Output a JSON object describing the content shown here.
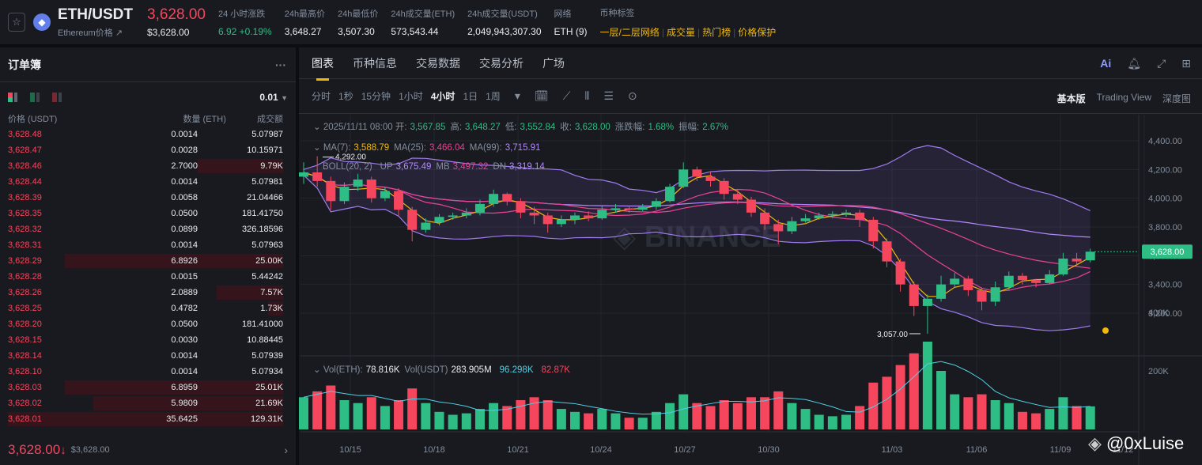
{
  "header": {
    "pair": "ETH/USDT",
    "subtitle": "Ethereum价格",
    "price": "3,628.00",
    "price_usd": "$3,628.00",
    "stats": [
      {
        "label": "24 小时涨跌",
        "value": "6.92 +0.19%",
        "color": "green"
      },
      {
        "label": "24h最高价",
        "value": "3,648.27"
      },
      {
        "label": "24h最低价",
        "value": "3,507.30"
      },
      {
        "label": "24h成交量(ETH)",
        "value": "573,543.44"
      },
      {
        "label": "24h成交量(USDT)",
        "value": "2,049,943,307.30"
      },
      {
        "label": "网络",
        "value": "ETH (9)"
      }
    ],
    "tags_label": "币种标签",
    "tags": [
      "一层/二层网络",
      "成交量",
      "热门榜",
      "价格保护"
    ]
  },
  "orderbook": {
    "title": "订单簿",
    "more": "···",
    "precision": "0.01",
    "cols": [
      "价格 (USDT)",
      "数量 (ETH)",
      "成交额"
    ],
    "rows": [
      [
        "3,628.48",
        "0.0014",
        "5.07987"
      ],
      [
        "3,628.47",
        "0.0028",
        "10.15971"
      ],
      [
        "3,628.46",
        "2.7000",
        "9.79K"
      ],
      [
        "3,628.44",
        "0.0014",
        "5.07981"
      ],
      [
        "3,628.39",
        "0.0058",
        "21.04466"
      ],
      [
        "3,628.35",
        "0.0500",
        "181.41750"
      ],
      [
        "3,628.32",
        "0.0899",
        "326.18596"
      ],
      [
        "3,628.31",
        "0.0014",
        "5.07963"
      ],
      [
        "3,628.29",
        "6.8926",
        "25.00K"
      ],
      [
        "3,628.28",
        "0.0015",
        "5.44242"
      ],
      [
        "3,628.26",
        "2.0889",
        "7.57K"
      ],
      [
        "3,628.25",
        "0.4782",
        "1.73K"
      ],
      [
        "3,628.20",
        "0.0500",
        "181.41000"
      ],
      [
        "3,628.15",
        "0.0030",
        "10.88445"
      ],
      [
        "3,628.14",
        "0.0014",
        "5.07939"
      ],
      [
        "3,628.10",
        "0.0014",
        "5.07934"
      ],
      [
        "3,628.03",
        "6.8959",
        "25.01K"
      ],
      [
        "3,628.02",
        "5.9809",
        "21.69K"
      ],
      [
        "3,628.01",
        "35.6425",
        "129.31K"
      ]
    ],
    "last_price": "3,628.00",
    "last_arrow": "↓",
    "last_usd": "$3,628.00"
  },
  "tabs": [
    "图表",
    "币种信息",
    "交易数据",
    "交易分析",
    "广场"
  ],
  "toolbar": {
    "intervals": [
      "分时",
      "1秒",
      "15分钟",
      "1小时",
      "4小时",
      "1日",
      "1周"
    ],
    "active": "4小时",
    "views": [
      "基本版",
      "Trading View",
      "深度图"
    ],
    "active_view": "基本版"
  },
  "legend": {
    "date": "2025/11/11 08:00",
    "ohlc": [
      [
        "开:",
        "3,567.85"
      ],
      [
        "高:",
        "3,648.27"
      ],
      [
        "低:",
        "3,552.84"
      ],
      [
        "收:",
        "3,628.00"
      ],
      [
        "涨跌幅:",
        "1.68%"
      ],
      [
        "振幅:",
        "2.67%"
      ]
    ],
    "ma": [
      [
        "MA(7):",
        "3,588.79",
        "#f0b90b"
      ],
      [
        "MA(25):",
        "3,466.04",
        "#e84393"
      ],
      [
        "MA(99):",
        "3,715.91",
        "#b388ff"
      ]
    ],
    "boll": [
      [
        "BOLL(20, 2)",
        ""
      ],
      [
        "UP",
        "3,675.49"
      ],
      [
        "MB",
        "3,497.32"
      ],
      [
        "DN",
        "3,319.14"
      ]
    ],
    "vol": [
      [
        "Vol(ETH):",
        "78.816K",
        "#eaecef"
      ],
      [
        "Vol(USDT)",
        "283.905M",
        "#eaecef"
      ],
      [
        "",
        "96.298K",
        "#4fd1e5"
      ],
      [
        "",
        "82.87K",
        "#f6465d"
      ]
    ]
  },
  "watermark": "@0xLuise",
  "colors": {
    "up": "#2ebd85",
    "down": "#f6465d",
    "accent": "#f0b90b"
  },
  "chart_data": {
    "type": "candlestick",
    "interval_label": "4小时",
    "y_ticks": [
      3200,
      3400,
      3600,
      3800,
      4000,
      4200,
      4400
    ],
    "y_tick_labels": [
      "3,200.00",
      "3,400.00",
      "3,600.00",
      "3,800.00",
      "4,000.00",
      "4,200.00",
      "4,400.00"
    ],
    "vol_ticks": [
      "200K",
      "400K"
    ],
    "x_ticks": [
      "10/15",
      "10/18",
      "10/21",
      "10/24",
      "10/27",
      "10/30",
      "11/03",
      "11/06",
      "11/09",
      "11/12"
    ],
    "current_price": "3,628.00",
    "max_label": "4,292.00",
    "min_label": "3,057.00",
    "candles": [
      [
        "10/13 08",
        4150,
        4250,
        4100,
        4180,
        110
      ],
      [
        "10/13 20",
        4180,
        4292,
        4080,
        4120,
        130
      ],
      [
        "10/14 08",
        4120,
        4150,
        3920,
        3980,
        150
      ],
      [
        "10/14 20",
        3980,
        4110,
        3960,
        4080,
        100
      ],
      [
        "10/15 08",
        4080,
        4170,
        4050,
        4130,
        90
      ],
      [
        "10/15 20",
        4130,
        4150,
        3970,
        4000,
        110
      ],
      [
        "10/16 08",
        4000,
        4080,
        3980,
        4050,
        80
      ],
      [
        "10/16 20",
        4050,
        4070,
        3880,
        3920,
        100
      ],
      [
        "10/17 08",
        3920,
        3940,
        3700,
        3780,
        140
      ],
      [
        "10/17 20",
        3780,
        3860,
        3760,
        3830,
        90
      ],
      [
        "10/18 08",
        3830,
        3890,
        3810,
        3870,
        60
      ],
      [
        "10/18 20",
        3870,
        3900,
        3850,
        3880,
        50
      ],
      [
        "10/19 08",
        3880,
        3930,
        3860,
        3900,
        55
      ],
      [
        "10/19 20",
        3900,
        3990,
        3880,
        3960,
        70
      ],
      [
        "10/20 08",
        3960,
        4060,
        3940,
        4030,
        90
      ],
      [
        "10/20 20",
        4030,
        4040,
        3950,
        3980,
        80
      ],
      [
        "10/21 08",
        3980,
        4000,
        3860,
        3900,
        100
      ],
      [
        "10/21 20",
        3900,
        3940,
        3820,
        3880,
        110
      ],
      [
        "10/22 08",
        3880,
        3900,
        3760,
        3820,
        100
      ],
      [
        "10/22 20",
        3820,
        3880,
        3800,
        3850,
        70
      ],
      [
        "10/23 08",
        3850,
        3900,
        3820,
        3880,
        60
      ],
      [
        "10/23 20",
        3880,
        3910,
        3840,
        3860,
        55
      ],
      [
        "10/24 08",
        3860,
        3950,
        3850,
        3920,
        70
      ],
      [
        "10/24 20",
        3920,
        3960,
        3900,
        3930,
        55
      ],
      [
        "10/25 08",
        3930,
        3950,
        3900,
        3920,
        40
      ],
      [
        "10/25 20",
        3920,
        3960,
        3910,
        3940,
        40
      ],
      [
        "10/26 08",
        3940,
        4000,
        3920,
        3980,
        60
      ],
      [
        "10/26 20",
        3980,
        4100,
        3970,
        4080,
        90
      ],
      [
        "10/27 08",
        4080,
        4250,
        4070,
        4200,
        120
      ],
      [
        "10/27 20",
        4200,
        4220,
        4120,
        4150,
        90
      ],
      [
        "10/28 08",
        4150,
        4180,
        4080,
        4120,
        80
      ],
      [
        "10/28 20",
        4120,
        4140,
        3990,
        4030,
        100
      ],
      [
        "10/29 08",
        4030,
        4060,
        3960,
        3990,
        90
      ],
      [
        "10/29 20",
        3990,
        4010,
        3870,
        3900,
        110
      ],
      [
        "10/30 08",
        3900,
        3930,
        3780,
        3820,
        110
      ],
      [
        "10/30 20",
        3820,
        3850,
        3680,
        3770,
        130
      ],
      [
        "10/31 08",
        3770,
        3870,
        3750,
        3840,
        90
      ],
      [
        "10/31 20",
        3840,
        3890,
        3830,
        3860,
        70
      ],
      [
        "11/01 08",
        3860,
        3900,
        3850,
        3880,
        50
      ],
      [
        "11/01 20",
        3880,
        3910,
        3860,
        3890,
        45
      ],
      [
        "11/02 08",
        3890,
        3920,
        3870,
        3900,
        50
      ],
      [
        "11/02 20",
        3900,
        3920,
        3800,
        3850,
        80
      ],
      [
        "11/03 08",
        3850,
        3870,
        3650,
        3700,
        160
      ],
      [
        "11/03 20",
        3700,
        3720,
        3520,
        3560,
        180
      ],
      [
        "11/04 08",
        3560,
        3580,
        3350,
        3400,
        220
      ],
      [
        "11/04 20",
        3400,
        3420,
        3180,
        3250,
        260
      ],
      [
        "11/05 08",
        3250,
        3330,
        3057,
        3300,
        300
      ],
      [
        "11/05 20",
        3300,
        3460,
        3280,
        3400,
        200
      ],
      [
        "11/06 08",
        3400,
        3480,
        3380,
        3440,
        120
      ],
      [
        "11/06 20",
        3440,
        3460,
        3320,
        3360,
        110
      ],
      [
        "11/07 08",
        3360,
        3380,
        3220,
        3280,
        120
      ],
      [
        "11/07 20",
        3280,
        3420,
        3250,
        3380,
        100
      ],
      [
        "11/08 08",
        3380,
        3490,
        3360,
        3460,
        90
      ],
      [
        "11/08 20",
        3460,
        3480,
        3400,
        3430,
        60
      ],
      [
        "11/09 08",
        3430,
        3440,
        3380,
        3410,
        55
      ],
      [
        "11/09 20",
        3410,
        3500,
        3400,
        3470,
        70
      ],
      [
        "11/10 08",
        3470,
        3620,
        3460,
        3580,
        110
      ],
      [
        "11/10 20",
        3580,
        3620,
        3530,
        3560,
        80
      ],
      [
        "11/11 08",
        3567.85,
        3648.27,
        3552.84,
        3628,
        78.8
      ]
    ]
  }
}
